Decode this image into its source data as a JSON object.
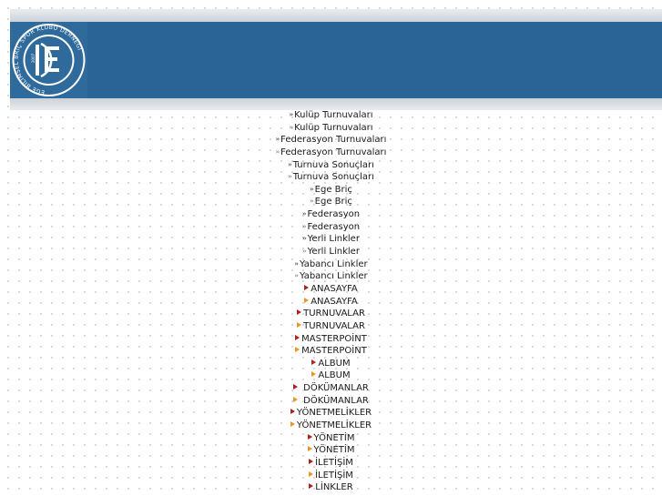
{
  "logo": {
    "text": "EGE BİLİMSEL BRİÇ SPOR KLUBÜ DERNEĞİ",
    "year": "2007"
  },
  "menu": {
    "items": [
      {
        "label": "Kulüp Turnuvaları",
        "marker": "arrows"
      },
      {
        "label": "Kulüp Turnuvaları",
        "marker": "arrows-light"
      },
      {
        "label": "Federasyon Turnuvaları",
        "marker": "arrows"
      },
      {
        "label": "Federasyon Turnuvaları",
        "marker": "arrows-light"
      },
      {
        "label": "Turnuva Sonuçları",
        "marker": "arrows"
      },
      {
        "label": "Turnuva Sonuçları",
        "marker": "arrows-light"
      },
      {
        "label": "Ege Briç",
        "marker": "arrows"
      },
      {
        "label": "Ege Briç",
        "marker": "arrows-light"
      },
      {
        "label": "Federasyon",
        "marker": "arrows"
      },
      {
        "label": "Federasyon",
        "marker": "arrows-light"
      },
      {
        "label": "Yerli Linkler",
        "marker": "arrows"
      },
      {
        "label": "Yerli Linkler",
        "marker": "arrows-light"
      },
      {
        "label": "Yabancı Linkler",
        "marker": "arrows"
      },
      {
        "label": "Yabancı Linkler",
        "marker": "arrows-light"
      },
      {
        "label": "ANASAYFA",
        "marker": "triangle-red"
      },
      {
        "label": "ANASAYFA",
        "marker": "triangle-orange"
      },
      {
        "label": "TURNUVALAR",
        "marker": "triangle-red"
      },
      {
        "label": "TURNUVALAR",
        "marker": "triangle-orange"
      },
      {
        "label": "MASTERPOİNT",
        "marker": "triangle-red"
      },
      {
        "label": "MASTERPOİNT",
        "marker": "triangle-orange"
      },
      {
        "label": "ALBUM",
        "marker": "triangle-red"
      },
      {
        "label": "ALBUM",
        "marker": "triangle-orange"
      },
      {
        "label": "DÖKÜMANLAR",
        "marker": "triangle-red"
      },
      {
        "label": "DÖKÜMANLAR",
        "marker": "triangle-orange"
      },
      {
        "label": "YÖNETMELİKLER",
        "marker": "triangle-red"
      },
      {
        "label": "YÖNETMELİKLER",
        "marker": "triangle-orange"
      },
      {
        "label": "YÖNETİM",
        "marker": "triangle-red"
      },
      {
        "label": "YÖNETİM",
        "marker": "triangle-orange"
      },
      {
        "label": "İLETİŞİM",
        "marker": "triangle-red"
      },
      {
        "label": "İLETİŞİM",
        "marker": "triangle-orange"
      },
      {
        "label": "LİNKLER",
        "marker": "triangle-red"
      }
    ]
  },
  "colors": {
    "header": "#2a6496",
    "triangle_red": "#b0201c",
    "triangle_orange": "#e8962a"
  }
}
